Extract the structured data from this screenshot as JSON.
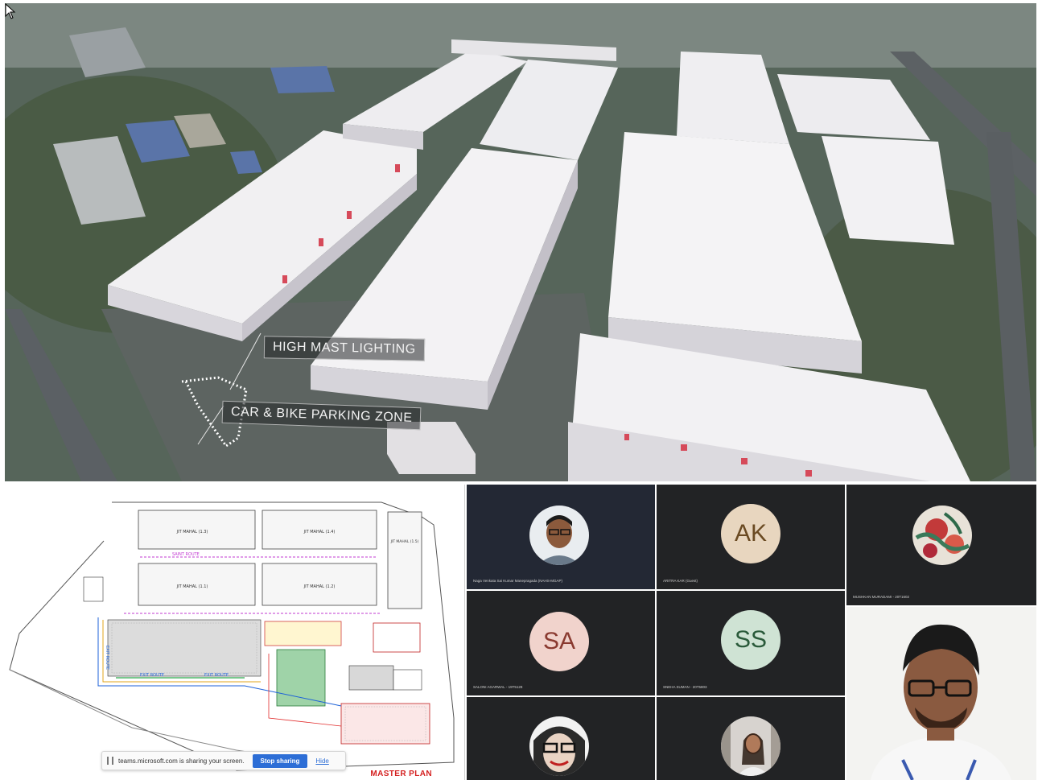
{
  "shared_render": {
    "callouts": {
      "lighting": "HIGH MAST LIGHTING",
      "parking": "CAR & BIKE PARKING ZONE"
    }
  },
  "master_plan": {
    "title": "MASTER PLAN",
    "blocks": [
      {
        "id": "B3",
        "label": "JIT MAHAL (1.3)"
      },
      {
        "id": "B4",
        "label": "JIT MAHAL (1.4)"
      },
      {
        "id": "B5",
        "label": "JIT MAHAL (1.5)"
      },
      {
        "id": "B1",
        "label": "JIT MAHAL (1.1)"
      },
      {
        "id": "B2",
        "label": "JIT MAHAL (1.2)"
      }
    ],
    "routes": [
      "SAINT ROUTE",
      "EXIT ROUTE",
      "EXIT ROUTE"
    ],
    "side_labels": [
      "EXIT ROUTE"
    ]
  },
  "share_bar": {
    "message": "teams.microsoft.com is sharing your screen.",
    "stop_label": "Stop sharing",
    "hide_label": "Hide"
  },
  "participants": [
    {
      "type": "photo",
      "name": "Naga Venkata Sai Kumar Manepragada (NAHS-MGAP)",
      "icon": "avatar-man"
    },
    {
      "type": "initials",
      "initials": "AK",
      "name": "ARITRA KAR (Guest)",
      "color": "#e8d6bf"
    },
    {
      "type": "photo",
      "name": "MUSHKAN MURADAMI - 20T1602",
      "icon": "avatar-floral"
    },
    {
      "type": "initials",
      "initials": "SA",
      "name": "SALONI AGARWAL - 19T5128",
      "color": "#f1d3cc"
    },
    {
      "type": "initials",
      "initials": "SS",
      "name": "SNEHA SUMAN - 20T5803",
      "color": "#cfe3d4"
    },
    {
      "type": "photo",
      "icon": "avatar-glasses"
    },
    {
      "type": "photo",
      "icon": "avatar-woman"
    }
  ],
  "colors": {
    "accent": "#2d6ed6",
    "plan_title": "#d42020",
    "tile_bg": "#222325"
  }
}
